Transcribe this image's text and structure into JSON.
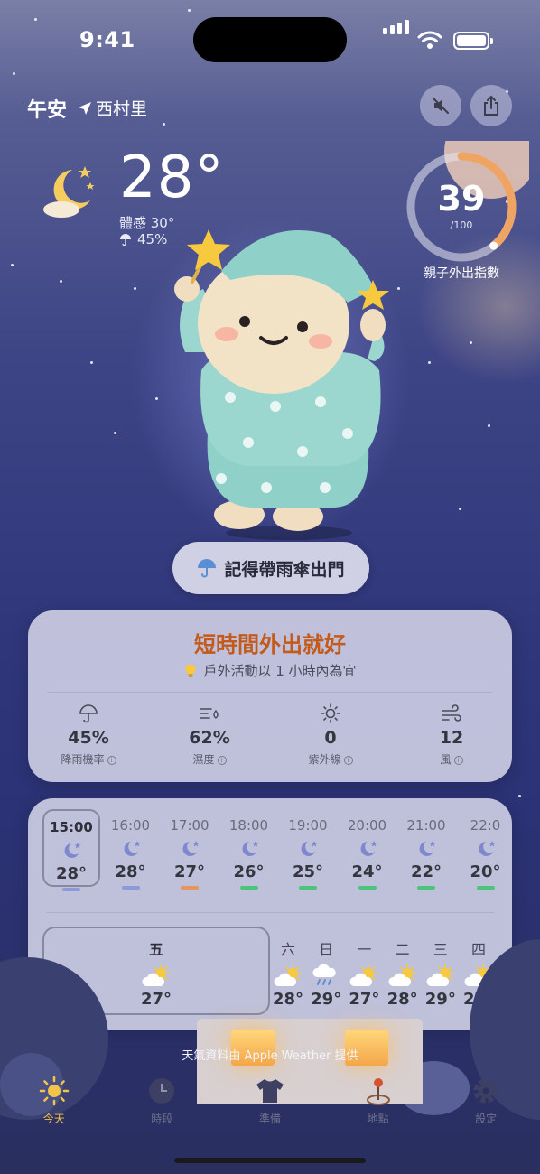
{
  "status_bar": {
    "time": "9:41"
  },
  "header": {
    "greeting": "午安",
    "location": "西村里"
  },
  "current": {
    "temperature": "28°",
    "feels_like": "體感 30°",
    "rain_chance": "45%"
  },
  "outing_index": {
    "value": "39",
    "max": "/100",
    "label": "親子外出指數",
    "fraction": 0.39
  },
  "reminder": "記得帶雨傘出門",
  "advice": {
    "headline": "短時間外出就好",
    "tip": "戶外活動以 1 小時內為宜",
    "metrics": [
      {
        "icon": "umbrella-icon",
        "value": "45%",
        "label": "降雨機率"
      },
      {
        "icon": "humidity-icon",
        "value": "62%",
        "label": "濕度"
      },
      {
        "icon": "sun-icon",
        "value": "0",
        "label": "紫外線"
      },
      {
        "icon": "wind-icon",
        "value": "12",
        "label": "風"
      }
    ]
  },
  "hourly": [
    {
      "time": "15:00",
      "temp": "28°",
      "bar": "#8c9ad8",
      "selected": true
    },
    {
      "time": "16:00",
      "temp": "28°",
      "bar": "#8c9ad8"
    },
    {
      "time": "17:00",
      "temp": "27°",
      "bar": "#e7955f"
    },
    {
      "time": "18:00",
      "temp": "26°",
      "bar": "#4cc47a"
    },
    {
      "time": "19:00",
      "temp": "25°",
      "bar": "#4cc47a"
    },
    {
      "time": "20:00",
      "temp": "24°",
      "bar": "#4cc47a"
    },
    {
      "time": "21:00",
      "temp": "22°",
      "bar": "#4cc47a"
    },
    {
      "time": "22:0",
      "temp": "20°",
      "bar": "#4cc47a"
    }
  ],
  "daily": {
    "today": {
      "label": "五",
      "temp": "27°",
      "icon": "partly-cloudy-icon"
    },
    "days": [
      {
        "label": "六",
        "temp": "28°",
        "icon": "partly-cloudy-icon"
      },
      {
        "label": "日",
        "temp": "29°",
        "icon": "rain-icon"
      },
      {
        "label": "一",
        "temp": "27°",
        "icon": "partly-cloudy-icon"
      },
      {
        "label": "二",
        "temp": "28°",
        "icon": "partly-cloudy-icon"
      },
      {
        "label": "三",
        "temp": "29°",
        "icon": "partly-cloudy-icon"
      },
      {
        "label": "四",
        "temp": "27°",
        "icon": "partly-cloudy-icon"
      }
    ]
  },
  "credit": "天氣資料由 Apple Weather 提供",
  "tabs": [
    {
      "label": "今天",
      "icon": "sun-icon",
      "active": true
    },
    {
      "label": "時段",
      "icon": "clock-icon"
    },
    {
      "label": "準備",
      "icon": "shirt-icon"
    },
    {
      "label": "地點",
      "icon": "map-pin-icon"
    },
    {
      "label": "設定",
      "icon": "gear-icon"
    }
  ],
  "colors": {
    "accent": "#f3c34a",
    "headline": "#c35a1a",
    "ring": "#f0a463"
  }
}
